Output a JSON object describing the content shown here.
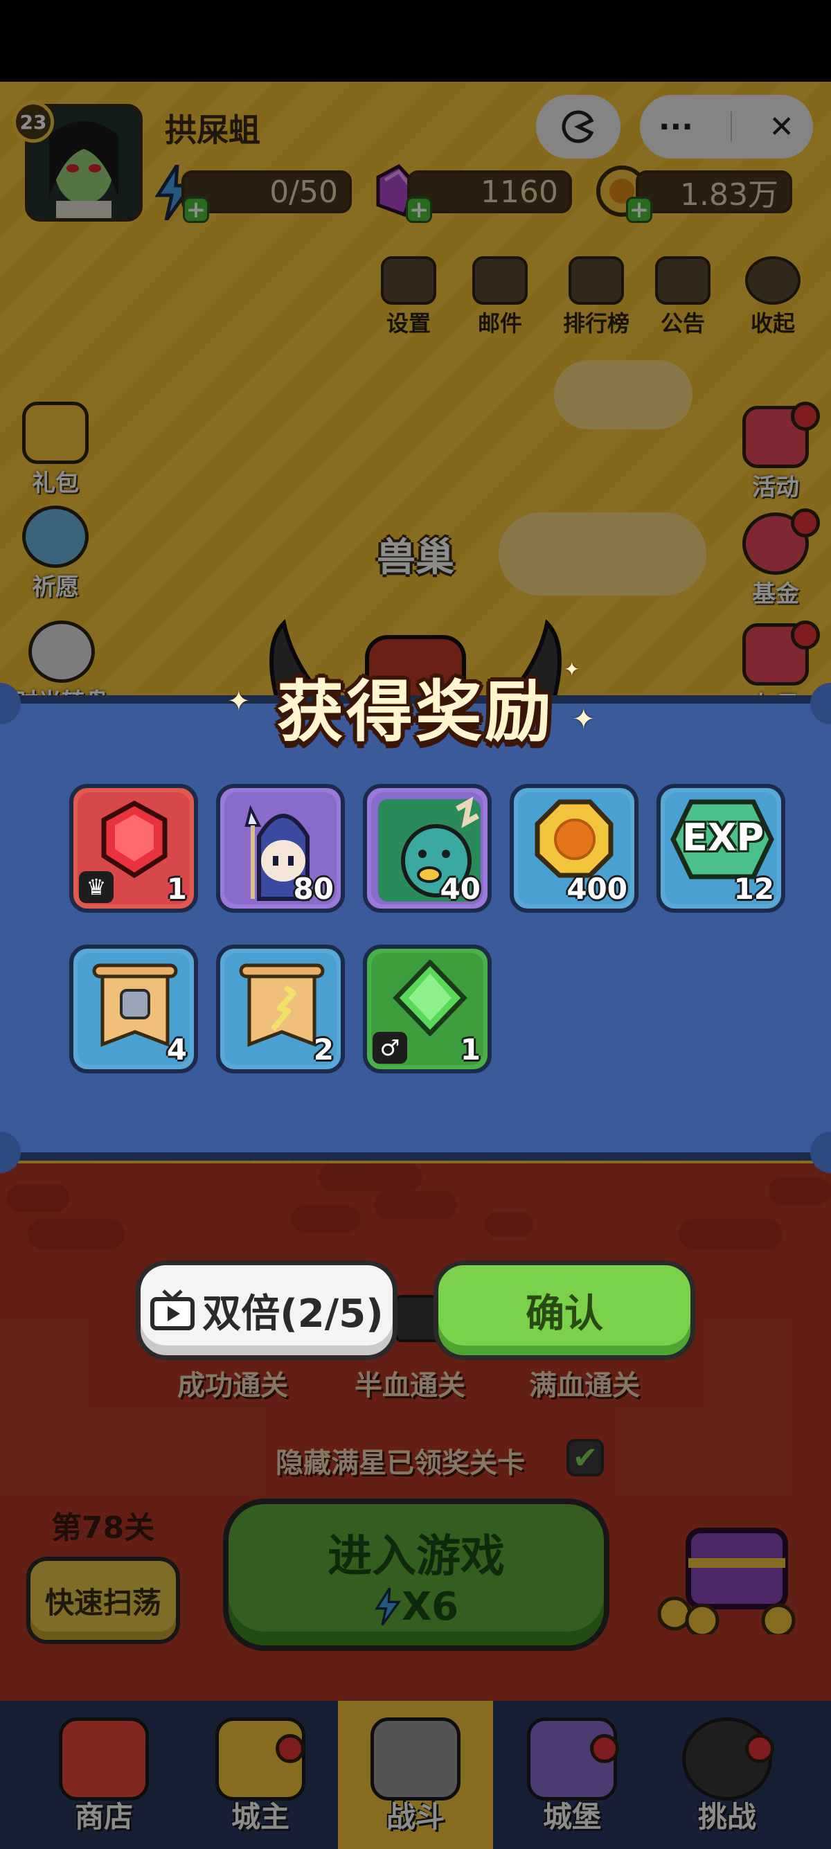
{
  "player": {
    "level": "23",
    "name": "拱屎蛆"
  },
  "resources": {
    "energy": "0/50",
    "gems": "1160",
    "gold": "1.83万"
  },
  "capsule": {
    "more": "···",
    "close": "✕"
  },
  "top_menu": [
    "设置",
    "邮件",
    "排行榜",
    "公告",
    "收起"
  ],
  "left_menu": [
    "礼包",
    "祈愿",
    "时光转盘"
  ],
  "right_menu": [
    "活动",
    "基金",
    "七日"
  ],
  "stage_area": "兽巢",
  "reward_dialog": {
    "title": "获得奖励",
    "items": [
      {
        "icon": "ruby-gem-icon",
        "qty": "1",
        "badge": "♛"
      },
      {
        "icon": "mage-hero-icon",
        "qty": "80"
      },
      {
        "icon": "dragon-hero-icon",
        "qty": "40"
      },
      {
        "icon": "gold-coin-icon",
        "qty": "400"
      },
      {
        "icon": "exp-icon",
        "qty": "12",
        "label": "EXP"
      },
      {
        "icon": "armor-scroll-icon",
        "qty": "4"
      },
      {
        "icon": "weapon-scroll-icon",
        "qty": "2"
      },
      {
        "icon": "green-gem-icon",
        "qty": "1",
        "badge": "♂"
      }
    ],
    "double_button": "双倍(2/5)",
    "confirm_button": "确认"
  },
  "stars": [
    "成功通关",
    "半血通关",
    "满血通关"
  ],
  "hide_option": "隐藏满星已领奖关卡",
  "stage": "第78关",
  "sweep_button": "快速扫荡",
  "enter_button": {
    "label": "进入游戏",
    "cost": "X6"
  },
  "nav": [
    "商店",
    "城主",
    "战斗",
    "城堡",
    "挑战"
  ],
  "colors": {
    "panel": "#3b5a9a",
    "confirm": "#7bd24a",
    "active_nav": "#f3c53d"
  }
}
